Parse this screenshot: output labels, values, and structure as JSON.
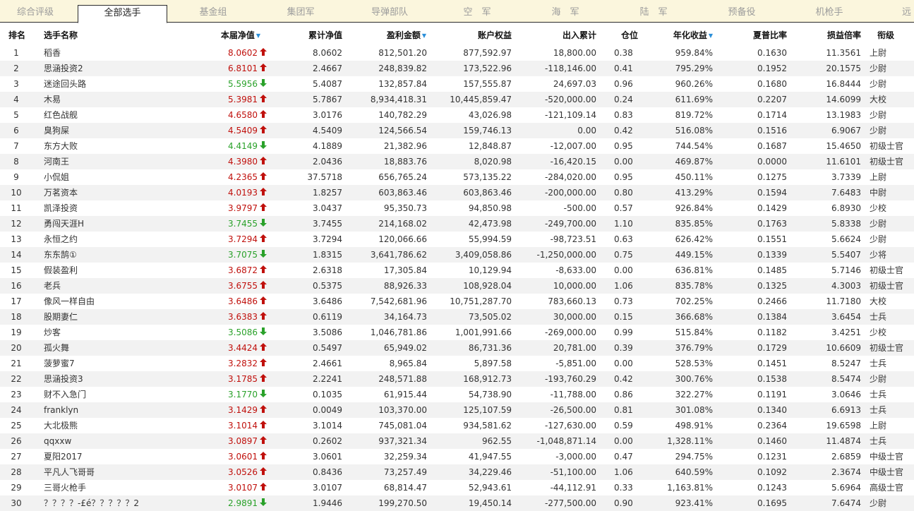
{
  "tabs": [
    "综合评级",
    "全部选手",
    "基金组",
    "集团军",
    "导弹部队",
    "空　军",
    "海　军",
    "陆　军",
    "预备役",
    "机枪手",
    "远"
  ],
  "active_tab": 1,
  "columns": {
    "rank": "排名",
    "name": "选手名称",
    "nav": "本届净值",
    "cum": "累计净值",
    "profit": "盈利金额",
    "equity": "账户权益",
    "flow": "出入累计",
    "pos": "仓位",
    "ann": "年化收益",
    "sharpe": "夏普比率",
    "pl": "损益倍率",
    "rank2": "衔级"
  },
  "sort_marker": "▼",
  "colors": {
    "up": "#c0100c",
    "down": "#2aa12a",
    "tabbar": "#fbf6dd",
    "stripe": "#f2f2f2"
  },
  "rows": [
    {
      "rank": "1",
      "name": "稻香",
      "nav": "8.0602",
      "dir": "up",
      "cum": "8.0602",
      "profit": "812,501.20",
      "equity": "877,592.97",
      "flow": "18,800.00",
      "pos": "0.38",
      "ann": "959.84%",
      "sharpe": "0.1630",
      "pl": "11.3561",
      "rank2": "上尉"
    },
    {
      "rank": "2",
      "name": "思涵投资2",
      "nav": "6.8101",
      "dir": "up",
      "cum": "2.4667",
      "profit": "248,839.82",
      "equity": "173,522.96",
      "flow": "-118,146.00",
      "pos": "0.41",
      "ann": "795.29%",
      "sharpe": "0.1952",
      "pl": "20.1575",
      "rank2": "少尉"
    },
    {
      "rank": "3",
      "name": "迷途回头路",
      "nav": "5.5956",
      "dir": "down",
      "cum": "5.4087",
      "profit": "132,857.84",
      "equity": "157,555.87",
      "flow": "24,697.03",
      "pos": "0.96",
      "ann": "960.26%",
      "sharpe": "0.1680",
      "pl": "16.8444",
      "rank2": "少尉"
    },
    {
      "rank": "4",
      "name": "木易",
      "nav": "5.3981",
      "dir": "up",
      "cum": "5.7867",
      "profit": "8,934,418.31",
      "equity": "10,445,859.47",
      "flow": "-520,000.00",
      "pos": "0.24",
      "ann": "611.69%",
      "sharpe": "0.2207",
      "pl": "14.6099",
      "rank2": "大校"
    },
    {
      "rank": "5",
      "name": "红色战舰",
      "nav": "4.6580",
      "dir": "up",
      "cum": "3.0176",
      "profit": "140,782.29",
      "equity": "43,026.98",
      "flow": "-121,109.14",
      "pos": "0.83",
      "ann": "819.72%",
      "sharpe": "0.1714",
      "pl": "13.1983",
      "rank2": "少尉"
    },
    {
      "rank": "6",
      "name": "臭狗屎",
      "nav": "4.5409",
      "dir": "up",
      "cum": "4.5409",
      "profit": "124,566.54",
      "equity": "159,746.13",
      "flow": "0.00",
      "pos": "0.42",
      "ann": "516.08%",
      "sharpe": "0.1516",
      "pl": "6.9067",
      "rank2": "少尉"
    },
    {
      "rank": "7",
      "name": "东方大败",
      "nav": "4.4149",
      "dir": "down",
      "cum": "4.1889",
      "profit": "21,382.96",
      "equity": "12,848.87",
      "flow": "-12,007.00",
      "pos": "0.95",
      "ann": "744.54%",
      "sharpe": "0.1687",
      "pl": "15.4650",
      "rank2": "初级士官"
    },
    {
      "rank": "8",
      "name": "河南王",
      "nav": "4.3980",
      "dir": "up",
      "cum": "2.0436",
      "profit": "18,883.76",
      "equity": "8,020.98",
      "flow": "-16,420.15",
      "pos": "0.00",
      "ann": "469.87%",
      "sharpe": "0.0000",
      "pl": "11.6101",
      "rank2": "初级士官"
    },
    {
      "rank": "9",
      "name": "小侃姐",
      "nav": "4.2365",
      "dir": "up",
      "cum": "37.5718",
      "profit": "656,765.24",
      "equity": "573,135.22",
      "flow": "-284,020.00",
      "pos": "0.95",
      "ann": "450.11%",
      "sharpe": "0.1275",
      "pl": "3.7339",
      "rank2": "上尉"
    },
    {
      "rank": "10",
      "name": "万茗资本",
      "nav": "4.0193",
      "dir": "up",
      "cum": "1.8257",
      "profit": "603,863.46",
      "equity": "603,863.46",
      "flow": "-200,000.00",
      "pos": "0.80",
      "ann": "413.29%",
      "sharpe": "0.1594",
      "pl": "7.6483",
      "rank2": "中尉"
    },
    {
      "rank": "11",
      "name": "凯泽投资",
      "nav": "3.9797",
      "dir": "up",
      "cum": "3.0437",
      "profit": "95,350.73",
      "equity": "94,850.98",
      "flow": "-500.00",
      "pos": "0.57",
      "ann": "926.84%",
      "sharpe": "0.1429",
      "pl": "6.8930",
      "rank2": "少校"
    },
    {
      "rank": "12",
      "name": "勇闯天涯H",
      "nav": "3.7455",
      "dir": "down",
      "cum": "3.7455",
      "profit": "214,168.02",
      "equity": "42,473.98",
      "flow": "-249,700.00",
      "pos": "1.10",
      "ann": "835.85%",
      "sharpe": "0.1763",
      "pl": "5.8338",
      "rank2": "少尉"
    },
    {
      "rank": "13",
      "name": "永恒之约",
      "nav": "3.7294",
      "dir": "up",
      "cum": "3.7294",
      "profit": "120,066.66",
      "equity": "55,994.59",
      "flow": "-98,723.51",
      "pos": "0.63",
      "ann": "626.42%",
      "sharpe": "0.1551",
      "pl": "5.6624",
      "rank2": "少尉"
    },
    {
      "rank": "14",
      "name": "东东鹄①",
      "nav": "3.7075",
      "dir": "down",
      "cum": "1.8315",
      "profit": "3,641,786.62",
      "equity": "3,409,058.86",
      "flow": "-1,250,000.00",
      "pos": "0.75",
      "ann": "449.15%",
      "sharpe": "0.1339",
      "pl": "5.5407",
      "rank2": "少将"
    },
    {
      "rank": "15",
      "name": "假装盈利",
      "nav": "3.6872",
      "dir": "up",
      "cum": "2.6318",
      "profit": "17,305.84",
      "equity": "10,129.94",
      "flow": "-8,633.00",
      "pos": "0.00",
      "ann": "636.81%",
      "sharpe": "0.1485",
      "pl": "5.7146",
      "rank2": "初级士官"
    },
    {
      "rank": "16",
      "name": "老兵",
      "nav": "3.6755",
      "dir": "up",
      "cum": "0.5375",
      "profit": "88,926.33",
      "equity": "108,928.04",
      "flow": "10,000.00",
      "pos": "1.06",
      "ann": "835.78%",
      "sharpe": "0.1325",
      "pl": "4.3003",
      "rank2": "初级士官"
    },
    {
      "rank": "17",
      "name": "像风一样自由",
      "nav": "3.6486",
      "dir": "up",
      "cum": "3.6486",
      "profit": "7,542,681.96",
      "equity": "10,751,287.70",
      "flow": "783,660.13",
      "pos": "0.73",
      "ann": "702.25%",
      "sharpe": "0.2466",
      "pl": "11.7180",
      "rank2": "大校"
    },
    {
      "rank": "18",
      "name": "股期妻仁",
      "nav": "3.6383",
      "dir": "up",
      "cum": "0.6119",
      "profit": "34,164.73",
      "equity": "73,505.02",
      "flow": "30,000.00",
      "pos": "0.15",
      "ann": "366.68%",
      "sharpe": "0.1384",
      "pl": "3.6454",
      "rank2": "士兵"
    },
    {
      "rank": "19",
      "name": "炒客",
      "nav": "3.5086",
      "dir": "down",
      "cum": "3.5086",
      "profit": "1,046,781.86",
      "equity": "1,001,991.66",
      "flow": "-269,000.00",
      "pos": "0.99",
      "ann": "515.84%",
      "sharpe": "0.1182",
      "pl": "3.4251",
      "rank2": "少校"
    },
    {
      "rank": "20",
      "name": "孤火舞",
      "nav": "3.4424",
      "dir": "up",
      "cum": "0.5497",
      "profit": "65,949.02",
      "equity": "86,731.36",
      "flow": "20,781.00",
      "pos": "0.39",
      "ann": "376.79%",
      "sharpe": "0.1729",
      "pl": "10.6609",
      "rank2": "初级士官"
    },
    {
      "rank": "21",
      "name": "菠萝蜜7",
      "nav": "3.2832",
      "dir": "up",
      "cum": "2.4661",
      "profit": "8,965.84",
      "equity": "5,897.58",
      "flow": "-5,851.00",
      "pos": "0.00",
      "ann": "528.53%",
      "sharpe": "0.1451",
      "pl": "8.5247",
      "rank2": "士兵"
    },
    {
      "rank": "22",
      "name": "思涵投资3",
      "nav": "3.1785",
      "dir": "up",
      "cum": "2.2241",
      "profit": "248,571.88",
      "equity": "168,912.73",
      "flow": "-193,760.29",
      "pos": "0.42",
      "ann": "300.76%",
      "sharpe": "0.1538",
      "pl": "8.5474",
      "rank2": "少尉"
    },
    {
      "rank": "23",
      "name": "财不入急门",
      "nav": "3.1770",
      "dir": "down",
      "cum": "0.1035",
      "profit": "61,915.44",
      "equity": "54,738.90",
      "flow": "-11,788.00",
      "pos": "0.86",
      "ann": "322.27%",
      "sharpe": "0.1191",
      "pl": "3.0646",
      "rank2": "士兵"
    },
    {
      "rank": "24",
      "name": "franklyn",
      "nav": "3.1429",
      "dir": "up",
      "cum": "0.0049",
      "profit": "103,370.00",
      "equity": "125,107.59",
      "flow": "-26,500.00",
      "pos": "0.81",
      "ann": "301.08%",
      "sharpe": "0.1340",
      "pl": "6.6913",
      "rank2": "士兵"
    },
    {
      "rank": "25",
      "name": "大北极熊",
      "nav": "3.1014",
      "dir": "up",
      "cum": "3.1014",
      "profit": "745,081.04",
      "equity": "934,581.62",
      "flow": "-127,630.00",
      "pos": "0.59",
      "ann": "498.91%",
      "sharpe": "0.2364",
      "pl": "19.6598",
      "rank2": "上尉"
    },
    {
      "rank": "26",
      "name": "qqxxw",
      "nav": "3.0897",
      "dir": "up",
      "cum": "0.2602",
      "profit": "937,321.34",
      "equity": "962.55",
      "flow": "-1,048,871.14",
      "pos": "0.00",
      "ann": "1,328.11%",
      "sharpe": "0.1460",
      "pl": "11.4874",
      "rank2": "士兵"
    },
    {
      "rank": "27",
      "name": "夏阳2017",
      "nav": "3.0601",
      "dir": "up",
      "cum": "3.0601",
      "profit": "32,259.34",
      "equity": "41,947.55",
      "flow": "-3,000.00",
      "pos": "0.47",
      "ann": "294.75%",
      "sharpe": "0.1231",
      "pl": "2.6859",
      "rank2": "中级士官"
    },
    {
      "rank": "28",
      "name": "平凡人飞哥哥",
      "nav": "3.0526",
      "dir": "up",
      "cum": "0.8436",
      "profit": "73,257.49",
      "equity": "34,229.46",
      "flow": "-51,100.00",
      "pos": "1.06",
      "ann": "640.59%",
      "sharpe": "0.1092",
      "pl": "2.3674",
      "rank2": "中级士官"
    },
    {
      "rank": "29",
      "name": "三哥火枪手",
      "nav": "3.0107",
      "dir": "up",
      "cum": "3.0107",
      "profit": "68,814.47",
      "equity": "52,943.61",
      "flow": "-44,112.91",
      "pos": "0.33",
      "ann": "1,163.81%",
      "sharpe": "0.1243",
      "pl": "5.6964",
      "rank2": "高级士官"
    },
    {
      "rank": "30",
      "name": "？？？？-£é？？？？？2",
      "nav": "2.9891",
      "dir": "down",
      "cum": "1.9446",
      "profit": "199,270.50",
      "equity": "19,450.14",
      "flow": "-277,500.00",
      "pos": "0.90",
      "ann": "923.41%",
      "sharpe": "0.1695",
      "pl": "7.6474",
      "rank2": "少尉"
    }
  ]
}
